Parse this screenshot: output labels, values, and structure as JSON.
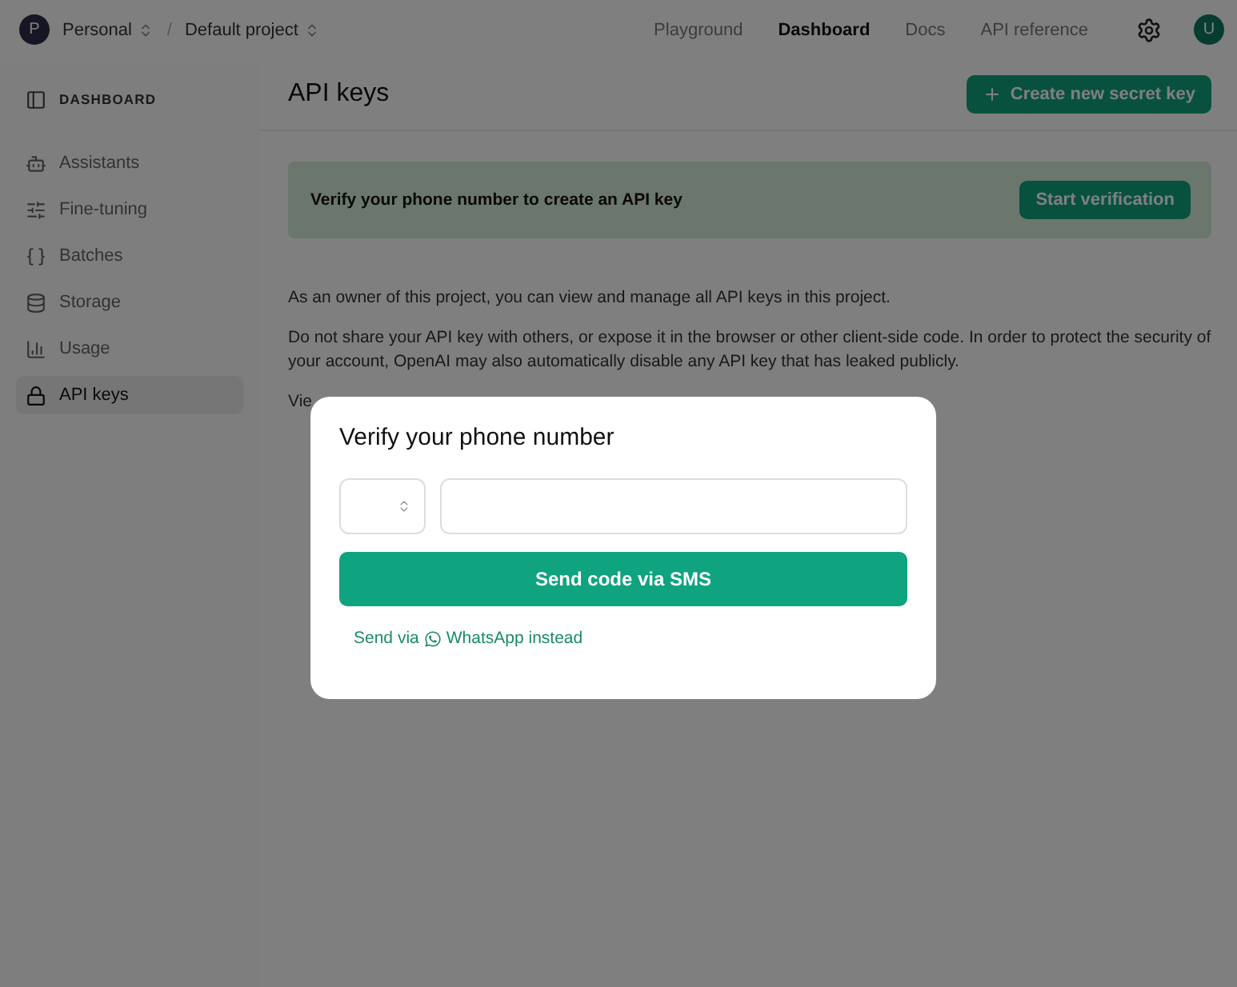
{
  "topbar": {
    "org": {
      "initial": "P",
      "name": "Personal"
    },
    "separator": "/",
    "project": "Default project",
    "nav": [
      {
        "label": "Playground",
        "selected": false
      },
      {
        "label": "Dashboard",
        "selected": true
      },
      {
        "label": "Docs",
        "selected": false
      },
      {
        "label": "API reference",
        "selected": false
      }
    ],
    "avatar": "U"
  },
  "sidebar": {
    "heading": "DASHBOARD",
    "items": [
      {
        "label": "Assistants",
        "selected": false
      },
      {
        "label": "Fine-tuning",
        "selected": false
      },
      {
        "label": "Batches",
        "selected": false
      },
      {
        "label": "Storage",
        "selected": false
      },
      {
        "label": "Usage",
        "selected": false
      },
      {
        "label": "API keys",
        "selected": true
      }
    ]
  },
  "main": {
    "title": "API keys",
    "create_button": "Create new secret key",
    "banner": {
      "text": "Verify your phone number to create an API key",
      "button": "Start verification"
    },
    "paragraphs": [
      "As an owner of this project, you can view and manage all API keys in this project.",
      "Do not share your API key with others, or expose it in the browser or other client-side code. In order to protect the security of your account, OpenAI may also automatically disable any API key that has leaked publicly.",
      "Vie"
    ]
  },
  "dialog": {
    "title": "Verify your phone number",
    "send_button": "Send code via SMS",
    "alt_link": {
      "before": "Send via",
      "after": "WhatsApp instead"
    }
  }
}
